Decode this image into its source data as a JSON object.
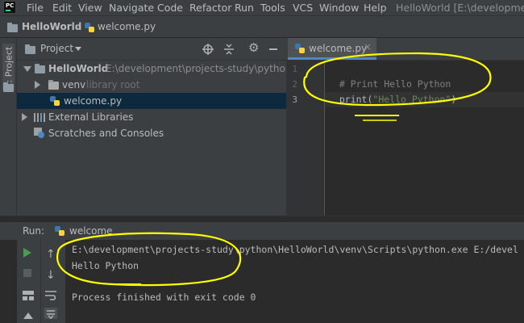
{
  "menubar": {
    "items": [
      "File",
      "Edit",
      "View",
      "Navigate",
      "Code",
      "Refactor",
      "Run",
      "Tools",
      "VCS",
      "Window",
      "Help"
    ],
    "window_title": "HelloWorld [E:\\development\\p",
    "app_logo_text": "PC"
  },
  "breadcrumb": {
    "project": "HelloWorld",
    "file": "welcome.py"
  },
  "side_strip": {
    "label": "1: Project"
  },
  "project_panel": {
    "title": "Project",
    "tree": [
      {
        "name": "HelloWorld",
        "detail": "E:\\development\\projects-study\\python\\Hell"
      },
      {
        "name": "venv",
        "detail": "library root"
      },
      {
        "name": "welcome.py",
        "detail": ""
      },
      {
        "name": "External Libraries",
        "detail": ""
      },
      {
        "name": "Scratches and Consoles",
        "detail": ""
      }
    ]
  },
  "editor": {
    "tab_label": "welcome.py",
    "line_numbers": [
      "1",
      "2",
      "3"
    ],
    "lines": {
      "comment": "# Print Hello Python",
      "call": "print",
      "open": "(",
      "string": "\"Hello Python\"",
      "close": ")"
    }
  },
  "run_panel": {
    "label": "Run:",
    "config_tab": "welcome",
    "console": [
      "E:\\development\\projects-study\\python\\HelloWorld\\venv\\Scripts\\python.exe E:/devel",
      "Hello Python",
      "",
      "Process finished with exit code 0"
    ]
  },
  "colors": {
    "accent": "#4a88c7",
    "selection": "#0d293e",
    "annotation": "#ffff00",
    "string": "#6a8759",
    "comment": "#808080",
    "run_green": "#499c54"
  }
}
